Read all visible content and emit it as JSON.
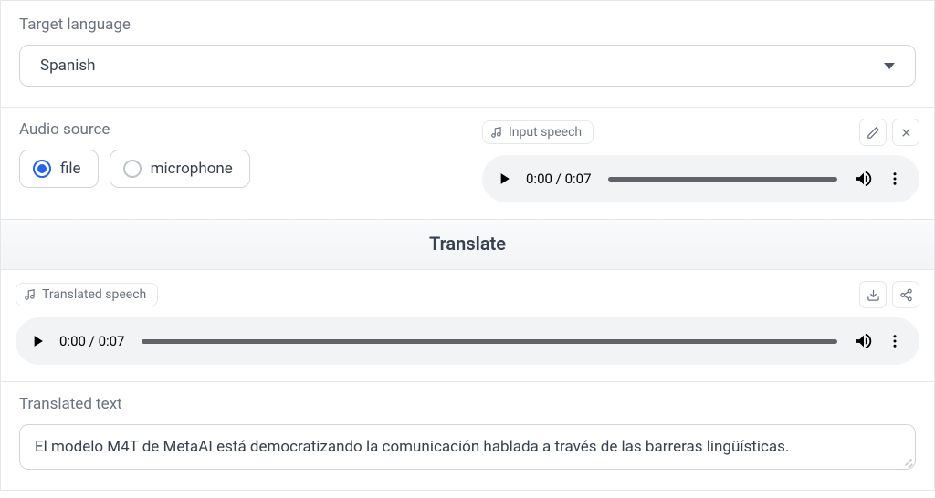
{
  "target_language": {
    "label": "Target language",
    "selected": "Spanish"
  },
  "audio_source": {
    "label": "Audio source",
    "options": [
      {
        "value": "file",
        "label": "file",
        "checked": true
      },
      {
        "value": "microphone",
        "label": "microphone",
        "checked": false
      }
    ]
  },
  "input_speech": {
    "label": "Input speech",
    "player": {
      "current": "0:00",
      "duration": "0:07"
    }
  },
  "translate_button": {
    "label": "Translate"
  },
  "translated_speech": {
    "label": "Translated speech",
    "player": {
      "current": "0:00",
      "duration": "0:07"
    }
  },
  "translated_text": {
    "label": "Translated text",
    "value": "El modelo M4T de MetaAI está democratizando la comunicación hablada a través de las barreras lingüísticas."
  }
}
